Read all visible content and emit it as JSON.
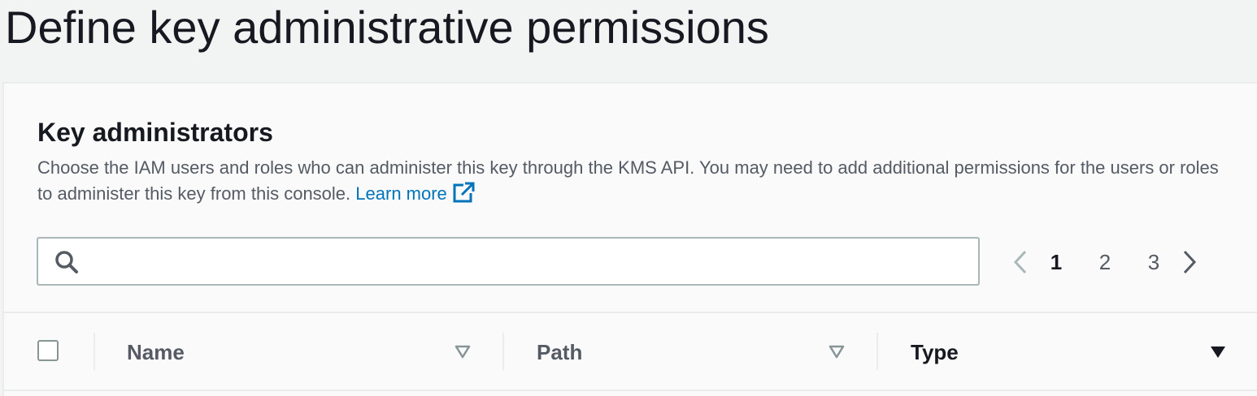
{
  "page": {
    "title": "Define key administrative permissions"
  },
  "panel": {
    "heading": "Key administrators",
    "description": "Choose the IAM users and roles who can administer this key through the KMS API. You may need to add additional permissions for the users or roles to administer this key from this console.",
    "learn_more": "Learn more",
    "learn_more_icon": "external-link-icon"
  },
  "search": {
    "value": "",
    "placeholder": "",
    "icon": "search-icon"
  },
  "pagination": {
    "pages": [
      "1",
      "2",
      "3"
    ],
    "current_page": "1",
    "prev_icon": "chevron-left-icon",
    "next_icon": "chevron-right-icon"
  },
  "table": {
    "columns": [
      {
        "label": "Name",
        "sort_icon": "sort-down-outline-icon"
      },
      {
        "label": "Path",
        "sort_icon": "sort-down-outline-icon"
      },
      {
        "label": "Type",
        "sort_icon": "sort-down-filled-icon"
      }
    ],
    "select_all_checked": false
  },
  "colors": {
    "link": "#0073bb",
    "text": "#16191f",
    "secondary_text": "#545b64",
    "disabled": "#aab7b8",
    "page_background": "#f2f3f3",
    "panel_background": "#fafafa"
  }
}
